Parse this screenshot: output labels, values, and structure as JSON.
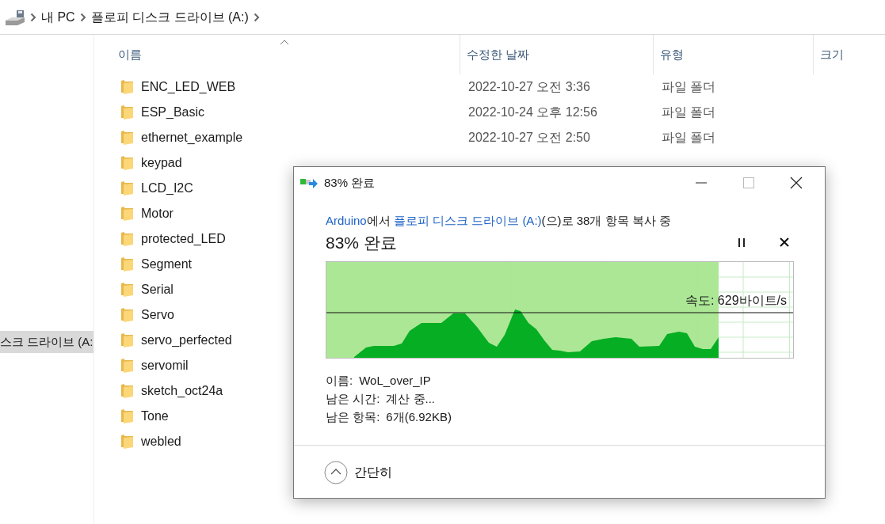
{
  "breadcrumb": [
    "내 PC",
    "플로피 디스크 드라이브 (A:)"
  ],
  "nav_pane": {
    "items": [
      {
        "label": "스크 드라이브 (A:",
        "selected": true
      }
    ]
  },
  "columns": [
    {
      "label": "이름",
      "sorted": true
    },
    {
      "label": "수정한 날짜",
      "sorted": false
    },
    {
      "label": "유형",
      "sorted": false
    },
    {
      "label": "크기",
      "sorted": false
    }
  ],
  "files": [
    {
      "name": "ENC_LED_WEB",
      "modified": "2022-10-27 오전 3:36",
      "type": "파일 폴더"
    },
    {
      "name": "ESP_Basic",
      "modified": "2022-10-24 오후 12:56",
      "type": "파일 폴더"
    },
    {
      "name": "ethernet_example",
      "modified": "2022-10-27 오전 2:50",
      "type": "파일 폴더"
    },
    {
      "name": "keypad"
    },
    {
      "name": "LCD_I2C"
    },
    {
      "name": "Motor"
    },
    {
      "name": "protected_LED"
    },
    {
      "name": "Segment"
    },
    {
      "name": "Serial"
    },
    {
      "name": "Servo"
    },
    {
      "name": "servo_perfected"
    },
    {
      "name": "servomil"
    },
    {
      "name": "sketch_oct24a"
    },
    {
      "name": "Tone"
    },
    {
      "name": "webled"
    }
  ],
  "dialog": {
    "title": "83% 완료",
    "copy_line": {
      "source": "Arduino",
      "source_suffix": "에서",
      "destination": "플로피 디스크 드라이브 (A:)",
      "rest": "(으)로 38개 항목 복사 중"
    },
    "status": "83% 완료",
    "progress": {
      "level": 0.84,
      "speed_label": "속도: 629바이트/s"
    },
    "details": [
      {
        "label": "이름:",
        "value": "WoL_over_IP"
      },
      {
        "label": "남은 시간:",
        "value": "계산 중..."
      },
      {
        "label": "남은 항목:",
        "value": "6개(6.92KB)"
      }
    ],
    "toggle_button": {
      "label": "간단히",
      "expanded": true
    }
  }
}
